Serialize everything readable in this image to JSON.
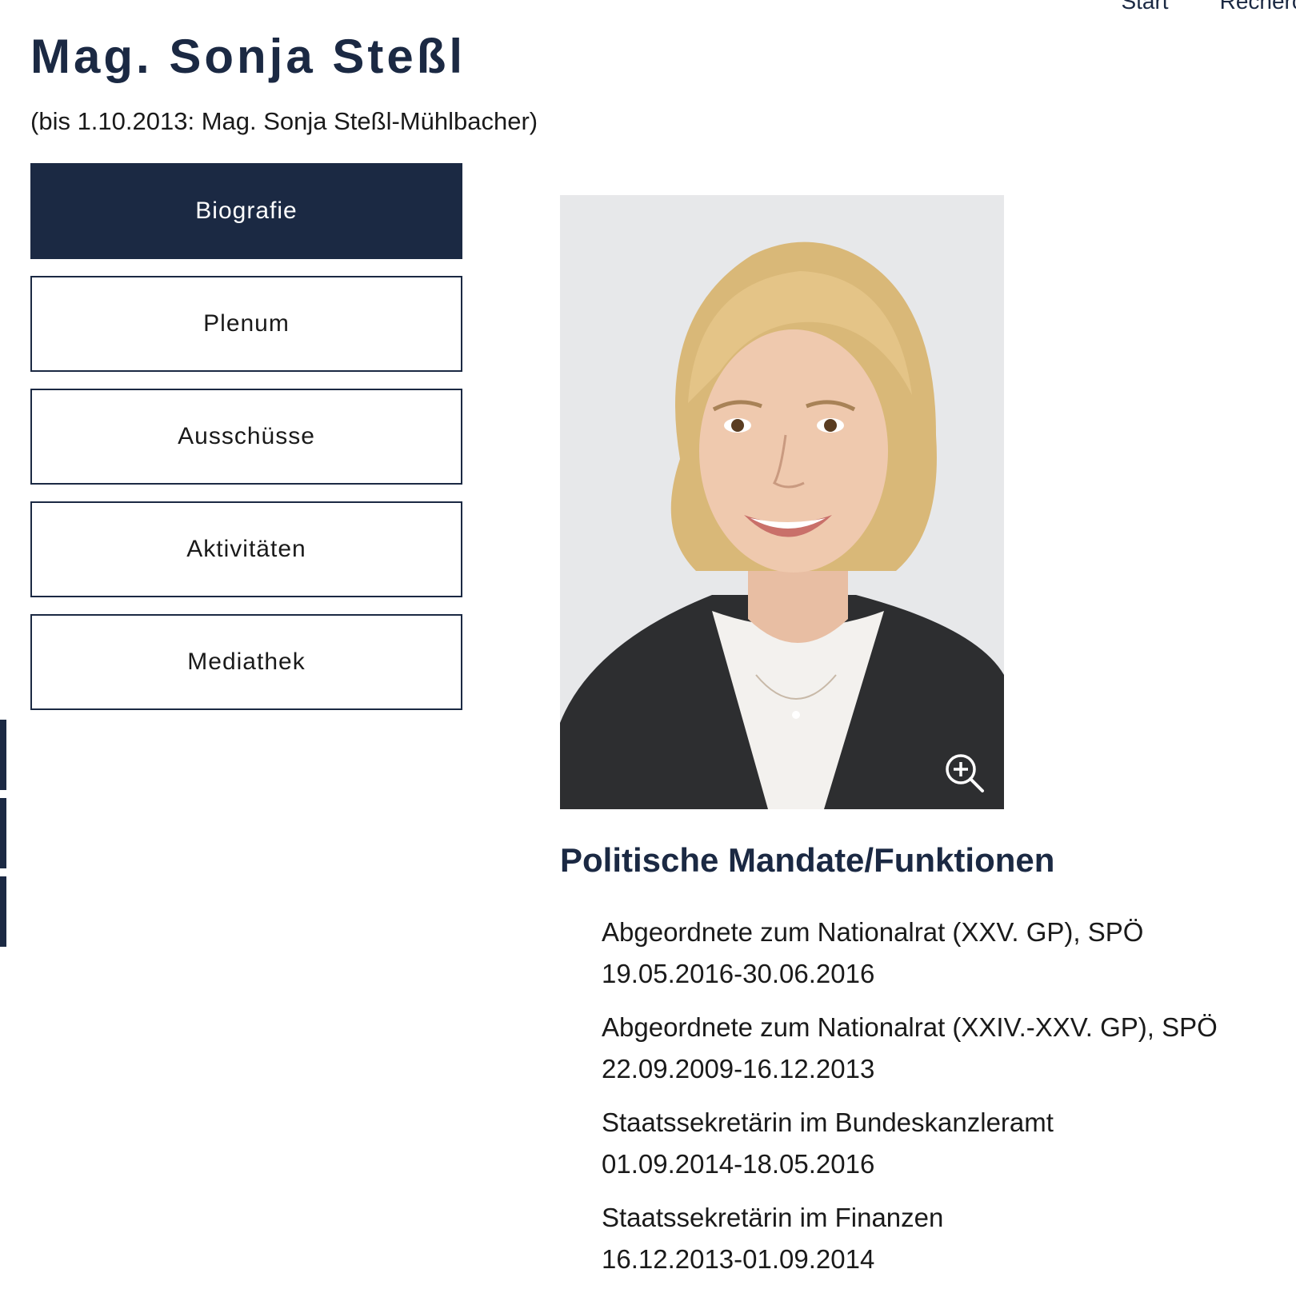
{
  "nav": {
    "start_label": "Start",
    "recherche_label": "Recherche"
  },
  "person": {
    "name": "Mag. Sonja Steßl",
    "former_name": "(bis 1.10.2013: Mag. Sonja Steßl-Mühlbacher)"
  },
  "tabs": [
    {
      "label": "Biografie",
      "active": true
    },
    {
      "label": "Plenum",
      "active": false
    },
    {
      "label": "Ausschüsse",
      "active": false
    },
    {
      "label": "Aktivitäten",
      "active": false
    },
    {
      "label": "Mediathek",
      "active": false
    }
  ],
  "photo": {
    "zoom_icon": "zoom-in-icon"
  },
  "mandates": {
    "heading": "Politische Mandate/Funktionen",
    "items": [
      {
        "title": "Abgeordnete zum Nationalrat (XXV. GP), SPÖ",
        "period": "19.05.2016-30.06.2016"
      },
      {
        "title": "Abgeordnete zum Nationalrat (XXIV.-XXV. GP), SPÖ",
        "period": "22.09.2009-16.12.2013"
      },
      {
        "title": "Staatssekretärin im Bundeskanzleramt",
        "period": "01.09.2014-18.05.2016"
      },
      {
        "title": "Staatssekretärin im Finanzen",
        "period": "16.12.2013-01.09.2014"
      }
    ]
  },
  "colors": {
    "primary": "#1b2943",
    "text": "#1a1a1a",
    "background": "#ffffff"
  }
}
